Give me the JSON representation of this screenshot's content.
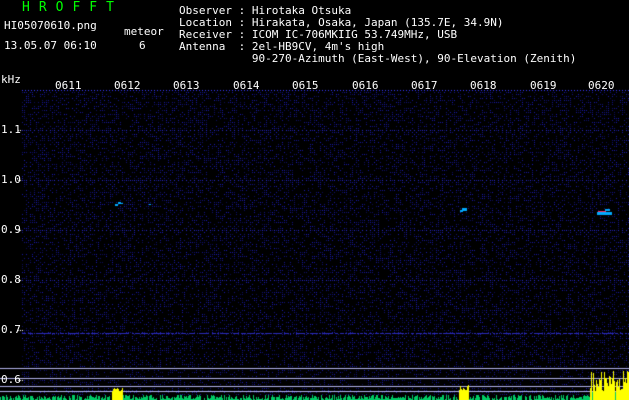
{
  "app": {
    "logo": "HROFFT"
  },
  "file": {
    "filename": "HI05070610.png",
    "datetime": "13.05.07 06:10",
    "meteor_label": "meteor",
    "meteor_count": "6"
  },
  "info": {
    "observer": "Observer : Hirotaka Otsuka",
    "location": "Location : Hirakata, Osaka, Japan (135.7E, 34.9N)",
    "receiver": "Receiver : ICOM IC-706MKIIG 53.749MHz, USB",
    "antenna": "Antenna  : 2el-HB9CV, 4m's high",
    "antenna2": "           90-270-Azimuth (East-West), 90-Elevation (Zenith)"
  },
  "axis": {
    "unit": "kHz",
    "y_labels": [
      "1.1",
      "1.0",
      "0.9",
      "0.8",
      "0.7",
      "0.6"
    ],
    "time_labels": [
      "0611",
      "0612",
      "0613",
      "0614",
      "0615",
      "0616",
      "0617",
      "0618",
      "0619",
      "0620"
    ]
  },
  "colors": {
    "background": "#000000",
    "noise": "#1a1a8a",
    "logo": "#00ff00",
    "meteor": "#00aaff",
    "peak": "#ffff00"
  }
}
